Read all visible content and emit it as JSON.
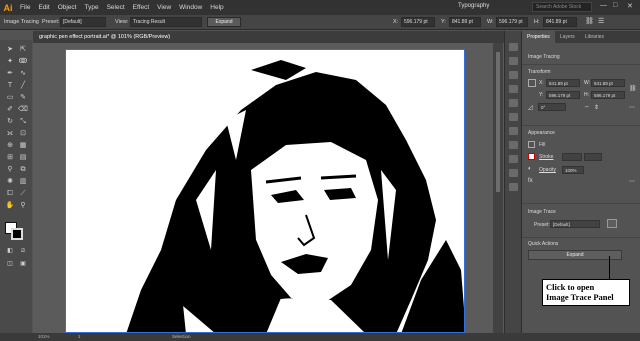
{
  "app": {
    "logo": "Ai"
  },
  "menu": [
    "File",
    "Edit",
    "Object",
    "Type",
    "Select",
    "Effect",
    "View",
    "Window",
    "Help"
  ],
  "workspace": "Typography",
  "search_placeholder": "Search Adobe Stock",
  "window_controls": [
    "—",
    "□",
    "✕"
  ],
  "control_bar": {
    "section_label": "Image Tracing",
    "preset_label": "Preset:",
    "preset_value": "[Default]",
    "view_label": "View:",
    "view_value": "Tracing Result",
    "expand_label": "Expand",
    "x_label": "X:",
    "x_value": "596.179 pt",
    "y_label": "Y:",
    "y_value": "841.89 pt",
    "w_label": "W:",
    "w_value": "596.179 pt",
    "h_label": "H:",
    "h_value": "841.89 pt"
  },
  "document_tab": "graphic pen effect portrait.ai* @ 101% (RGB/Preview)",
  "status_bar": {
    "zoom": "101%",
    "artboard": "1",
    "mode": "Selection"
  },
  "panel": {
    "tabs": [
      "Properties",
      "Layers",
      "Libraries"
    ],
    "object_type": "Image Tracing",
    "transform_title": "Transform",
    "x_label": "X:",
    "x_value": "841.89 pt",
    "y_label": "Y:",
    "y_value": "596.179 pt",
    "w_label": "W:",
    "w_value": "841.89 pt",
    "h_label": "H:",
    "h_value": "596.179 pt",
    "rotate_value": "0°",
    "appearance_title": "Appearance",
    "fill_label": "Fill",
    "stroke_label": "Stroke",
    "opacity_label": "Opacity",
    "opacity_value": "100%",
    "image_trace_title": "Image Trace",
    "image_trace_preset_label": "Preset:",
    "image_trace_preset_value": "[Default]",
    "quick_actions_title": "Quick Actions",
    "expand_button": "Expand"
  },
  "callout": {
    "line1": "Click to open",
    "line2": "Image Trace Panel"
  }
}
